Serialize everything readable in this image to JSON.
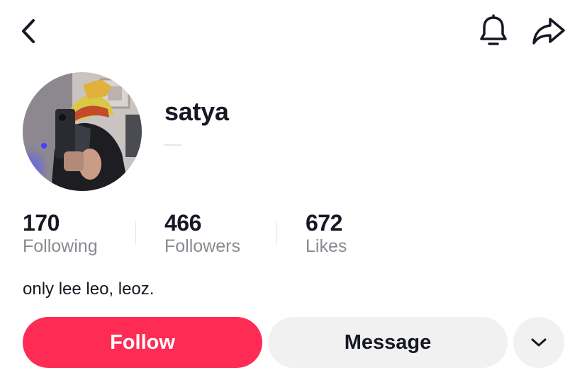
{
  "header": {
    "back_icon": "chevron-left-icon",
    "notification_icon": "bell-icon",
    "share_icon": "share-arrow-icon"
  },
  "profile": {
    "username": "satya",
    "avatar": "profile-photo-mirror-selfie",
    "stats": [
      {
        "value": "170",
        "label": "Following"
      },
      {
        "value": "466",
        "label": "Followers"
      },
      {
        "value": "672",
        "label": "Likes"
      }
    ],
    "bio": "only lee leo, leoz."
  },
  "actions": {
    "follow_label": "Follow",
    "message_label": "Message",
    "more_icon": "chevron-down-icon"
  },
  "colors": {
    "follow_bg": "#fe2c55",
    "secondary_bg": "#f1f1f2",
    "label_gray": "#8a8b91",
    "text": "#161823"
  }
}
